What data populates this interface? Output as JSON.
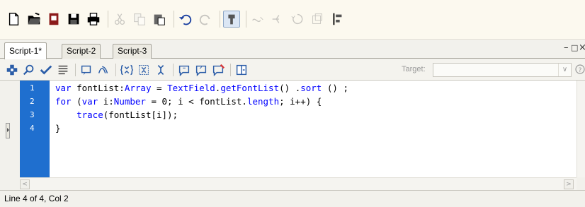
{
  "app_toolbar": {
    "buttons": [
      {
        "name": "new-file-icon"
      },
      {
        "name": "open-folder-icon"
      },
      {
        "name": "import-icon"
      },
      {
        "name": "save-icon"
      },
      {
        "name": "print-icon"
      },
      {
        "name": "cut-icon",
        "disabled": true
      },
      {
        "name": "copy-icon",
        "disabled": true
      },
      {
        "name": "paste-icon"
      },
      {
        "name": "undo-icon"
      },
      {
        "name": "redo-icon",
        "disabled": true
      },
      {
        "name": "snap-to-object-icon",
        "pressed": true
      },
      {
        "name": "smooth-icon",
        "disabled": true
      },
      {
        "name": "straighten-icon",
        "disabled": true
      },
      {
        "name": "rotate-icon",
        "disabled": true
      },
      {
        "name": "scale-icon",
        "disabled": true
      },
      {
        "name": "align-icon"
      }
    ]
  },
  "tabs": [
    {
      "label": "Script-1*",
      "active": true
    },
    {
      "label": "Script-2",
      "active": false
    },
    {
      "label": "Script-3",
      "active": false
    }
  ],
  "window_controls": {
    "minimize": "–",
    "restore": "□",
    "close": "×"
  },
  "code_toolbar": {
    "buttons": [
      "add-statement-icon",
      "find-icon",
      "check-syntax-icon",
      "auto-format-icon",
      "show-code-hint-icon",
      "debug-options-icon",
      "collapse-between-braces-icon",
      "collapse-selection-icon",
      "expand-all-icon",
      "apply-block-comment-icon",
      "apply-line-comment-icon",
      "remove-comment-icon",
      "show-hide-toolbox-icon"
    ],
    "target_label": "Target:",
    "target_value": ""
  },
  "editor": {
    "lines": [
      {
        "num": "1",
        "text": "var fontList:Array = TextField.getFontList() .sort () ;"
      },
      {
        "num": "2",
        "text": "for (var i:Number = 0; i < fontList.length; i++) {"
      },
      {
        "num": "3",
        "text": "    trace(fontList[i]);"
      },
      {
        "num": "4",
        "text": "}"
      }
    ]
  },
  "status": {
    "text": "Line 4 of 4, Col 2"
  }
}
